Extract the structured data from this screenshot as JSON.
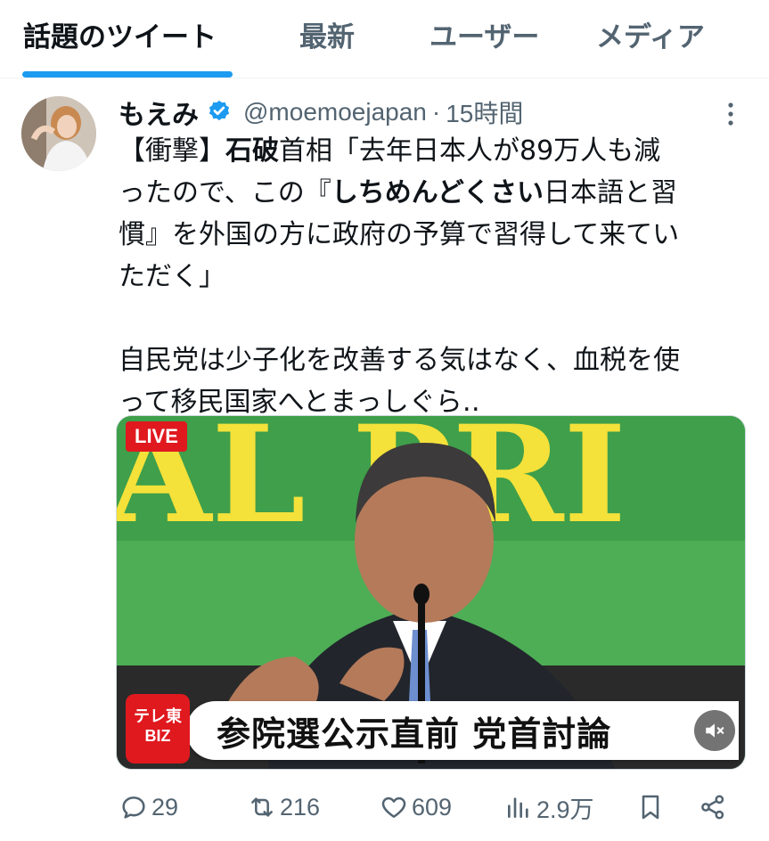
{
  "tabs": [
    {
      "label": "話題のツイート",
      "active": true
    },
    {
      "label": "最新",
      "active": false
    },
    {
      "label": "ユーザー",
      "active": false
    },
    {
      "label": "メディア",
      "active": false
    }
  ],
  "tweet": {
    "author_name": "もえみ",
    "handle": "@moemoejapan",
    "separator": "·",
    "time": "15時間",
    "text_lines": [
      [
        "【衝撃】",
        "石破",
        "首相「去年日本人が89万人も減"
      ],
      [
        "ったので、この『",
        "しちめんどくさい",
        "日本語と習"
      ],
      [
        "慣』を外国の方に政府の予算で習得して来てい"
      ],
      [
        "ただく」"
      ],
      [
        "自民党は少子化を改善する気はなく、血税を使"
      ],
      [
        "って移民国家へとまっしぐら‥"
      ]
    ]
  },
  "media": {
    "live_label": "LIVE",
    "tv_logo_line1": "テレ東",
    "tv_logo_line2": "BIZ",
    "caption": "参院選公示直前 党首討論",
    "backdrop_text": "AL PRI"
  },
  "actions": {
    "reply_count": "29",
    "retweet_count": "216",
    "like_count": "609",
    "views_count": "2.9万"
  },
  "colors": {
    "accent": "#1d9bf0",
    "text_primary": "#0f1419",
    "text_secondary": "#536471",
    "live_red": "#e0191f",
    "backdrop_green": "#4dae55",
    "backdrop_yellow": "#f4e13a"
  },
  "icons": {
    "verified": "verified-badge-icon",
    "more": "more-vertical-icon",
    "reply": "reply-icon",
    "retweet": "retweet-icon",
    "like": "heart-icon",
    "views": "views-bar-icon",
    "bookmark": "bookmark-icon",
    "share": "share-icon",
    "mute": "muted-speaker-icon"
  }
}
